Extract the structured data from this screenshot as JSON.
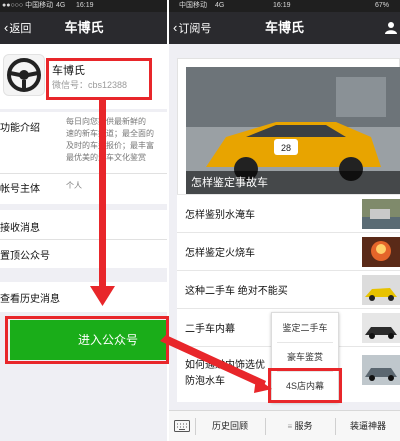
{
  "left": {
    "status": {
      "carrier": "●●○○○ 中国移动",
      "network": "4G",
      "time": "16:19"
    },
    "nav": {
      "back": "返回",
      "title": "车博氏"
    },
    "profile": {
      "name": "车博氏",
      "wechat_id": "微信号：cbs12388"
    },
    "intro": {
      "label": "功能介绍",
      "lines": [
        "每日向您提供最新鲜的",
        "速的新车报道；最全面的",
        "及时的车型报价；最丰富",
        "最优美的汽车文化鉴赏"
      ]
    },
    "account_subject": {
      "label": "帐号主体",
      "value": "个人"
    },
    "receive_messages": {
      "label": "接收消息"
    },
    "pin_account": {
      "label": "置顶公众号"
    },
    "history": {
      "label": "查看历史消息"
    },
    "enter_button": {
      "label": "进入公众号"
    }
  },
  "right": {
    "status": {
      "carrier": "中国移动",
      "network": "4G",
      "time": "16:19",
      "battery": "67%"
    },
    "nav": {
      "back": "订阅号",
      "title": "车博氏",
      "profile_icon": "person-icon"
    },
    "hero": {
      "caption": "怎样鉴定事故车"
    },
    "articles": [
      {
        "title": "怎样鉴别水淹车"
      },
      {
        "title": "怎样鉴定火烧车"
      },
      {
        "title": "这种二手车 绝对不能买"
      },
      {
        "title": "二手车内幕"
      },
      {
        "title_line1": "如何通过内饰选优",
        "title_line1_tail": "谨",
        "title_line2": "防泡水车"
      }
    ],
    "popup_menu": [
      "鉴定二手车",
      "豪车鉴赏",
      "4S店内幕"
    ],
    "bottom_bar": {
      "keyboard_icon": "keyboard-icon",
      "tabs": [
        "历史回顾",
        "服务",
        "装逼神器"
      ]
    }
  },
  "colors": {
    "annotation_red": "#e8262a",
    "wechat_green": "#1aad19",
    "nav_bg": "#2a2a2e"
  }
}
